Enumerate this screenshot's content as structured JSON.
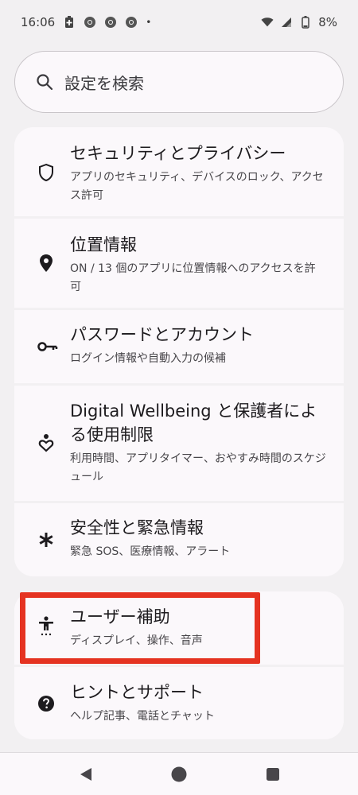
{
  "status": {
    "time": "16:06",
    "dot": "•",
    "battery_pct": "8%"
  },
  "search": {
    "placeholder": "設定を検索"
  },
  "settings": [
    {
      "title": "セキュリティとプライバシー",
      "subtitle": "アプリのセキュリティ、デバイスのロック、アクセス許可",
      "icon": "shield-icon"
    },
    {
      "title": "位置情報",
      "subtitle": "ON / 13 個のアプリに位置情報へのアクセスを許可",
      "icon": "location-pin-icon"
    },
    {
      "title": "パスワードとアカウント",
      "subtitle": "ログイン情報や自動入力の候補",
      "icon": "key-icon"
    },
    {
      "title": "Digital Wellbeing と保護者による使用制限",
      "subtitle": "利用時間、アプリタイマー、おやすみ時間のスケジュール",
      "icon": "wellbeing-heart-icon"
    },
    {
      "title": "安全性と緊急情報",
      "subtitle": "緊急 SOS、医療情報、アラート",
      "icon": "asterisk-icon"
    },
    {
      "title": "ユーザー補助",
      "subtitle": "ディスプレイ、操作、音声",
      "icon": "accessibility-icon"
    },
    {
      "title": "ヒントとサポート",
      "subtitle": "ヘルプ記事、電話とチャット",
      "icon": "help-circle-icon"
    }
  ],
  "colors": {
    "background": "#f2f0f2",
    "card": "#fbf8fb",
    "highlight": "#e53321",
    "text": "#1d1b1e",
    "subtext": "#48464a"
  }
}
